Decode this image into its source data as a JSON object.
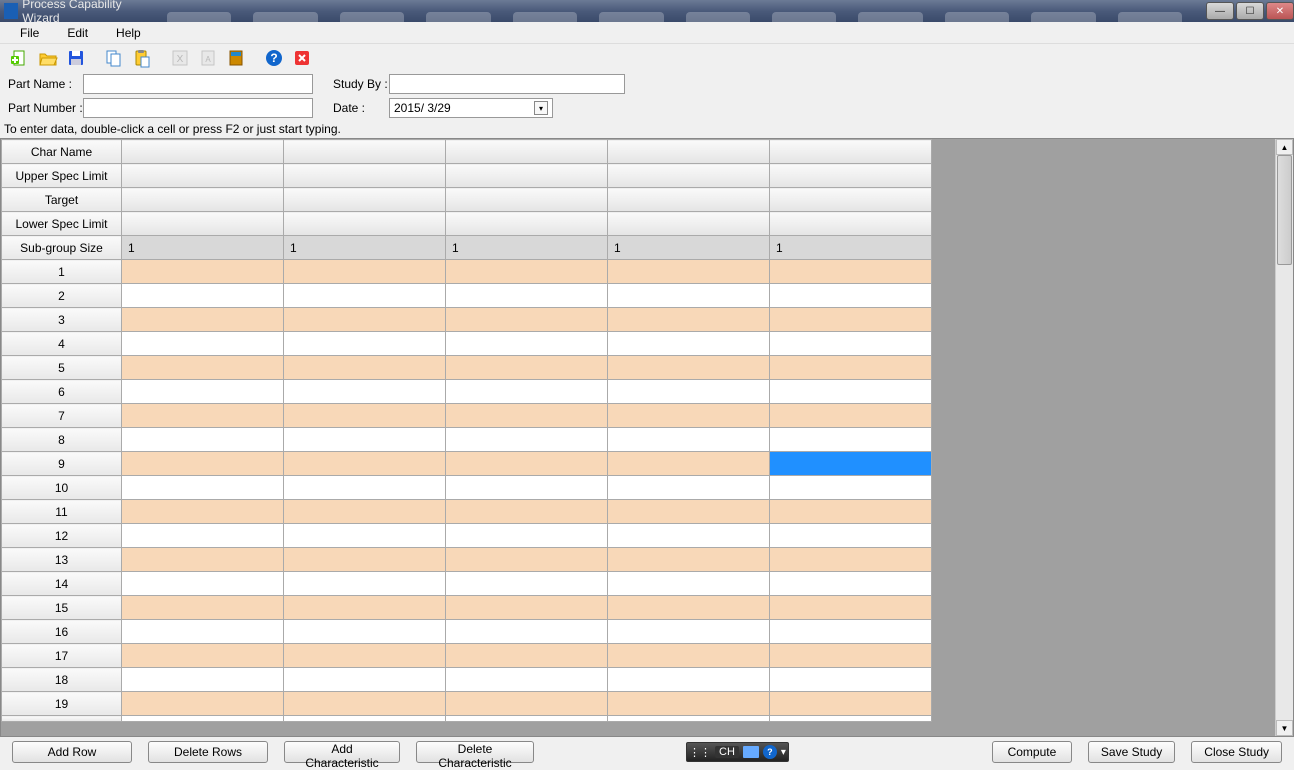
{
  "window": {
    "title": "Process Capability Wizard"
  },
  "menu": {
    "file": "File",
    "edit": "Edit",
    "help": "Help"
  },
  "form": {
    "partname_label": "Part Name :",
    "partname_value": "",
    "partnumber_label": "Part Number :",
    "partnumber_value": "",
    "studyby_label": "Study By :",
    "studyby_value": "",
    "date_label": "Date :",
    "date_value": "2015/ 3/29"
  },
  "hint": "To enter data, double-click a cell or press F2 or just start typing.",
  "table": {
    "headers": [
      "Char Name",
      "Upper Spec Limit",
      "Target",
      "Lower Spec Limit",
      "Sub-group Size"
    ],
    "subgroup_values": [
      "1",
      "1",
      "1",
      "1",
      "1"
    ],
    "num_data_cols": 5,
    "num_data_rows": 19,
    "selected_cell": {
      "row": 9,
      "col": 5
    }
  },
  "buttons": {
    "addrow": "Add Row",
    "deleterows": "Delete Rows",
    "addchar": "Add Characteristic",
    "delchar": "Delete Characteristic",
    "compute": "Compute",
    "savestudy": "Save Study",
    "closestudy": "Close Study"
  },
  "langbar": {
    "lang": "CH"
  }
}
